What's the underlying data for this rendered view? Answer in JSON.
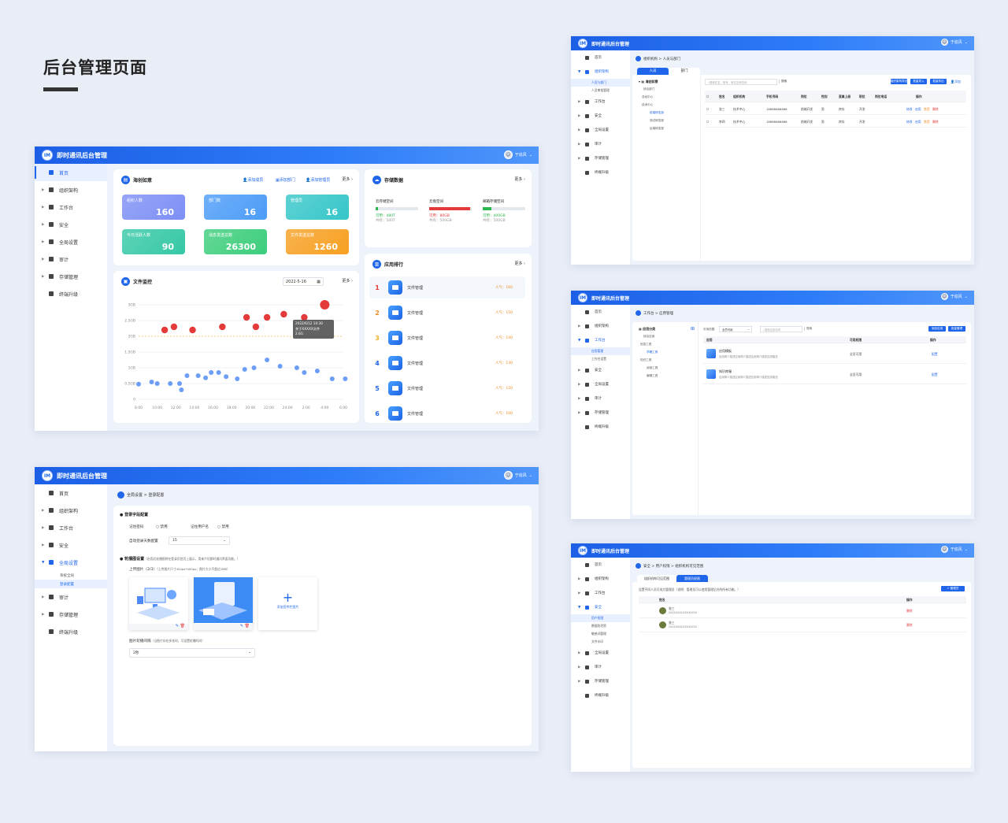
{
  "page": {
    "title": "后台管理页面"
  },
  "app": {
    "name": "即时通讯后台管理",
    "logo": "IM",
    "user": "于追风"
  },
  "nav": {
    "home": "首页",
    "org": "组织架构",
    "workbench": "工作台",
    "security": "安全",
    "global": "全局设置",
    "audit": "审计",
    "storage": "存储管理",
    "upgrade": "终端升级",
    "org_sub1": "人员与部门",
    "org_sub2": "人员审批管理",
    "wb_sub1": "应用管理",
    "wb_sub2": "工作台设置",
    "sec_sub1": "用户权限",
    "sec_sub2": "数据防泄密",
    "sec_sub3": "敏感词管理",
    "sec_sub4": "文件水印",
    "global_sub1": "系统全局",
    "global_sub2": "登录配置"
  },
  "dash": {
    "company": "海创如意",
    "add_member": "添加成员",
    "add_dept": "添加部门",
    "add_admin": "添加管理员",
    "more": "更多",
    "stats": [
      {
        "label": "组织人数",
        "value": "160",
        "color": "#7d8ff5"
      },
      {
        "label": "部门数",
        "value": "16",
        "color": "#4c9cf8"
      },
      {
        "label": "管理员",
        "value": "16",
        "color": "#36c6c9"
      },
      {
        "label": "今日活跃人数",
        "value": "90",
        "color": "#35c8a5"
      },
      {
        "label": "消息发送总数",
        "value": "26300",
        "color": "#3dce7c"
      },
      {
        "label": "文件发送总数",
        "value": "1260",
        "color": "#f7a022"
      }
    ],
    "storage_title": "存储数据",
    "storage": [
      {
        "name": "云存储空间",
        "avail": "可用：480T",
        "total": "共有：500T",
        "fill": 0.06,
        "color": "#2ab64a"
      },
      {
        "name": "云盘空间",
        "avail": "可用：80GB",
        "total": "共有：500GB",
        "fill": 0.96,
        "color": "#e53a3a"
      },
      {
        "name": "邮箱存储空间",
        "avail": "可用：400GB",
        "total": "共有：500GB",
        "fill": 0.2,
        "color": "#2ab64a"
      }
    ],
    "rank_title": "应用排行",
    "rank": [
      {
        "n": "1",
        "name": "文件管理",
        "hot": "人气：160",
        "c": "#e53a3a"
      },
      {
        "n": "2",
        "name": "文件管理",
        "hot": "人气：150",
        "c": "#f08a24"
      },
      {
        "n": "3",
        "name": "文件管理",
        "hot": "人气：140",
        "c": "#f2b02b"
      },
      {
        "n": "4",
        "name": "文件管理",
        "hot": "人气：130",
        "c": "#1f66ea"
      },
      {
        "n": "5",
        "name": "文件管理",
        "hot": "人气：120",
        "c": "#1f66ea"
      },
      {
        "n": "6",
        "name": "文件管理",
        "hot": "人气：100",
        "c": "#1f66ea"
      }
    ],
    "file_title": "文件监控",
    "date": "2022-5-16",
    "tooltip": {
      "time": "2022/6/12   10:30",
      "name": "关于XXXXX文件",
      "size": "2.6G"
    }
  },
  "chart_data": {
    "type": "scatter",
    "title": "文件监控",
    "xlabel": "",
    "ylabel": "",
    "x_ticks": [
      "8:00",
      "10:00",
      "12:00",
      "14:00",
      "16:00",
      "18:00",
      "20:00",
      "22:00",
      "24:00",
      "2:00",
      "4:00",
      "6:00"
    ],
    "y_ticks": [
      "0",
      "0.5GB",
      "1GB",
      "1.5GB",
      "2GB",
      "2.5GB",
      "3GB"
    ],
    "ylim": [
      0,
      3
    ],
    "series": [
      {
        "values": [
          [
            1.4,
            2.2
          ],
          [
            1.9,
            2.3
          ],
          [
            2.9,
            2.2
          ],
          [
            4.5,
            2.3
          ],
          [
            5.8,
            2.6
          ],
          [
            6.3,
            2.3
          ],
          [
            6.9,
            2.6
          ],
          [
            7.8,
            2.7
          ],
          [
            8.9,
            2.6
          ],
          [
            10,
            3
          ]
        ],
        "color": "#e53a3a"
      },
      {
        "values": [
          [
            0,
            0.48
          ],
          [
            0.7,
            0.55
          ],
          [
            1,
            0.5
          ],
          [
            1.7,
            0.5
          ],
          [
            2.2,
            0.5
          ],
          [
            2.3,
            0.3
          ],
          [
            2.6,
            0.75
          ],
          [
            3.2,
            0.75
          ],
          [
            3.6,
            0.68
          ],
          [
            3.9,
            0.85
          ],
          [
            4.3,
            0.85
          ],
          [
            4.7,
            0.72
          ],
          [
            5.3,
            0.65
          ],
          [
            5.7,
            0.95
          ],
          [
            6.2,
            1
          ],
          [
            6.9,
            1.25
          ],
          [
            7.6,
            1.05
          ],
          [
            8.5,
            1
          ],
          [
            8.9,
            0.85
          ],
          [
            9.6,
            0.9
          ],
          [
            10.4,
            0.65
          ],
          [
            11.1,
            0.65
          ]
        ],
        "color": "#6c9ef5"
      }
    ]
  },
  "login": {
    "crumb": "全局设置 > 登录配置",
    "s1": "登录字段配置",
    "remember_pwd": "记住密码",
    "off1": "禁用",
    "remember_user": "记住用户名",
    "off2": "禁用",
    "auto_lock": "自动登录天数配置",
    "days": "15",
    "s2": "轮播图设置",
    "s2_hint": "（启用后轮播图将在登录页首页上展示，用来介绍即时通讯界面功能。）",
    "upload": "上传图片（2/3）",
    "upload_hint": "（上传图片尺寸450px*400px；图片大小不超过2MB）",
    "add_img": "添加宣传栏图片",
    "interval": "图片轮播间隔",
    "interval_hint": "（当图片存在多张时，可设置轮播时间）",
    "interval_val": "2秒"
  },
  "org": {
    "crumb": "组织机构 > 人员与部门",
    "tab_people": "人员",
    "tab_dept": "部门",
    "root": "海创如意",
    "search_ph": "搜索姓名，账号，单位名称查询",
    "search_btn": "搜索",
    "tree": [
      "综合部门",
      "总经中心",
      "技术中心",
      "前端研发部",
      "测试研发部",
      "后端研发部"
    ],
    "btns": [
      "组织架构导出",
      "批量导入",
      "批量导出",
      "添加"
    ],
    "cols": [
      "姓名",
      "组织机构",
      "手机号码",
      "岗位",
      "性别",
      "直属上级",
      "职位",
      "岗位电话",
      "操作"
    ],
    "rows": [
      [
        "张三",
        "技术中心",
        "18666666666",
        "前端开发",
        "男",
        "库存",
        "开发",
        "",
        "修改",
        "启用",
        "禁用",
        "删除"
      ],
      [
        "李四",
        "技术中心",
        "18666666666",
        "前端开发",
        "男",
        "库存",
        "开发",
        "",
        "修改",
        "启用",
        "禁用",
        "删除"
      ]
    ]
  },
  "apps": {
    "crumb": "工作台 > 应用管理",
    "cat": "应用分类",
    "filter": "可用范围",
    "filter_val": "全员可用",
    "search_ph": "搜索应用名称",
    "search_btn": "搜索",
    "btn1": "添加应用",
    "btn2": "批量管理",
    "tree": [
      "综合应用",
      "信息工具",
      "学籍工具",
      "知识工具",
      "阅读工具",
      "编辑工具"
    ],
    "cols": [
      "应用",
      "可用权限",
      "操作"
    ],
    "rows": [
      {
        "name": "应用模板",
        "desc": "应用简介描述应用简介描述应用简介描述应用描述",
        "perm": "全员可用",
        "op": "配置"
      },
      {
        "name": "知识库服",
        "desc": "应用简介描述应用简介描述应用简介描述应用描述",
        "perm": "全员可用",
        "op": "配置"
      }
    ]
  },
  "perm": {
    "crumb": "安全 > 用户权限 > 组织机构可见范围",
    "tab1": "组织机构可见范围",
    "tab2": "管理员权限",
    "hint": "设置不同人员可成为管理员（说明：管理员可以使用管理后台的所有功能。）",
    "add": "+ 管理员",
    "cols": [
      "姓名",
      "操作"
    ],
    "rows": [
      {
        "name": "张三",
        "acct": "XXXXXXXX/XXXXXXXX",
        "op": "删除"
      },
      {
        "name": "张三",
        "acct": "XXXXXXXX/XXXXXXXX",
        "op": "删除"
      }
    ]
  }
}
